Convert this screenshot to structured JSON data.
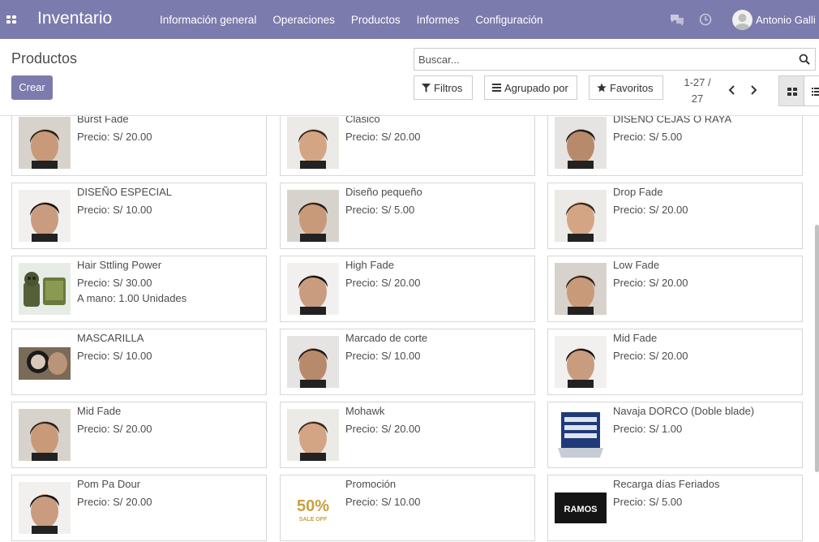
{
  "navbar": {
    "brand": "Inventario",
    "menu": [
      "Información general",
      "Operaciones",
      "Productos",
      "Informes",
      "Configuración"
    ],
    "user_name": "Antonio Galli",
    "icons": [
      "apps-icon",
      "chat-icon",
      "clock-icon",
      "avatar"
    ],
    "color": "#7c7bad"
  },
  "control_panel": {
    "title": "Productos",
    "create_label": "Crear",
    "search_placeholder": "Buscar...",
    "filters_label": "Filtros",
    "group_by_label": "Agrupado por",
    "favorites_label": "Favoritos",
    "pager_range": "1-27 /",
    "pager_total": "27"
  },
  "products": [
    {
      "name": "Burst Fade",
      "price": "Precio: S/ 20.00",
      "image": "haircut-photo"
    },
    {
      "name": "Clasico",
      "price": "Precio: S/ 20.00",
      "image": "haircut-photo"
    },
    {
      "name": "DISEÑO CEJAS O RAYA",
      "price": "Precio: S/ 5.00",
      "image": "haircut-photo"
    },
    {
      "name": "DISEÑO ESPECIAL",
      "price": "Precio: S/ 10.00",
      "image": "haircut-photo"
    },
    {
      "name": "Diseño pequeño",
      "price": "Precio: S/ 5.00",
      "image": "haircut-photo"
    },
    {
      "name": "Drop Fade",
      "price": "Precio: S/ 20.00",
      "image": "haircut-photo"
    },
    {
      "name": "Hair Sttling Power",
      "price": "Precio: S/ 30.00",
      "on_hand": "A mano: 1.00 Unidades",
      "image": "product-photo"
    },
    {
      "name": "High Fade",
      "price": "Precio: S/ 20.00",
      "image": "haircut-photo"
    },
    {
      "name": "Low Fade",
      "price": "Precio: S/ 20.00",
      "image": "haircut-photo"
    },
    {
      "name": "MASCARILLA",
      "price": "Precio: S/ 10.00",
      "image": "mask-photo"
    },
    {
      "name": "Marcado de corte",
      "price": "Precio: S/ 10.00",
      "image": "haircut-photo"
    },
    {
      "name": "Mid Fade",
      "price": "Precio: S/ 20.00",
      "image": "haircut-photo"
    },
    {
      "name": "Mid Fade",
      "price": "Precio: S/ 20.00",
      "image": "haircut-photo"
    },
    {
      "name": "Mohawk",
      "price": "Precio: S/ 20.00",
      "image": "haircut-photo"
    },
    {
      "name": "Navaja DORCO (Doble blade)",
      "price": "Precio: S/ 1.00",
      "image": "blade-box-photo"
    },
    {
      "name": "Pom Pa Dour",
      "price": "Precio: S/ 20.00",
      "image": "haircut-photo"
    },
    {
      "name": "Promoción",
      "price": "Precio: S/ 10.00",
      "image": "promo-logo",
      "image_text": "50%",
      "image_subtext": "SALE OFF"
    },
    {
      "name": "Recarga días Feriados",
      "price": "Precio: S/ 5.00",
      "image": "ramos-logo",
      "image_text": "RAMOS"
    }
  ]
}
